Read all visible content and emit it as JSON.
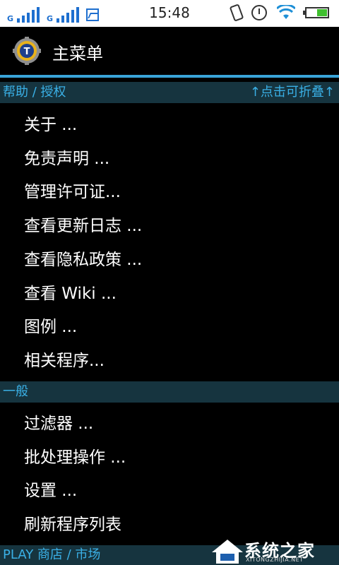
{
  "status_bar": {
    "time": "15:48",
    "sim1_tag": "G",
    "sim2_tag": "G"
  },
  "app": {
    "title": "主菜单",
    "icon": "titanium-backup-icon",
    "accent_color": "#3aa4d9"
  },
  "sections": [
    {
      "header": "帮助 / 授权",
      "header_right": "↑点击可折叠↑",
      "items": [
        "关于 ...",
        "免责声明 ...",
        "管理许可证...",
        "查看更新日志 ...",
        "查看隐私政策 ...",
        "查看 Wiki ...",
        "图例 ...",
        "相关程序..."
      ]
    },
    {
      "header": "一般",
      "items": [
        "过滤器 ...",
        "批处理操作 ...",
        "设置 ...",
        "刷新程序列表"
      ]
    },
    {
      "header": "PLAY 商店 / 市场"
    }
  ],
  "watermark": {
    "text": "系统之家",
    "sub": "XITONGZHIJIA.NET"
  }
}
